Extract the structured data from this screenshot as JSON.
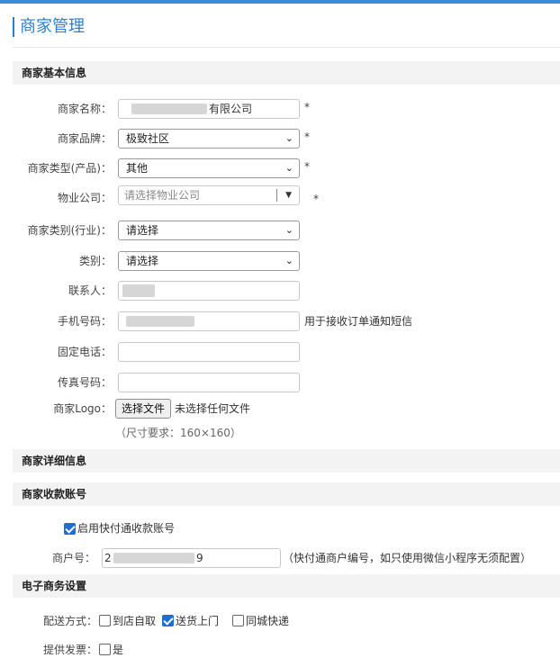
{
  "page": {
    "title": "商家管理"
  },
  "sections": {
    "basic": "商家基本信息",
    "detail": "商家详细信息",
    "account": "商家收款账号",
    "ecommerce": "电子商务设置"
  },
  "basic_form": {
    "name": {
      "label": "商家名称：",
      "value": "有限公司",
      "required_mark": "*"
    },
    "brand": {
      "label": "商家品牌：",
      "selected": "极致社区",
      "required_mark": "*"
    },
    "type": {
      "label": "商家类型(产品)：",
      "selected": "其他",
      "required_mark": "*"
    },
    "property": {
      "label": "物业公司：",
      "placeholder": "请选择物业公司",
      "required_mark": "*"
    },
    "industry": {
      "label": "商家类别(行业)：",
      "selected": "请选择"
    },
    "category": {
      "label": "类别：",
      "selected": "请选择"
    },
    "contact": {
      "label": "联系人：",
      "value": ""
    },
    "mobile": {
      "label": "手机号码：",
      "value": "",
      "hint": "用于接收订单通知短信"
    },
    "phone": {
      "label": "固定电话：",
      "value": ""
    },
    "fax": {
      "label": "传真号码：",
      "value": ""
    },
    "logo": {
      "label": "商家Logo：",
      "button": "选择文件",
      "status": "未选择任何文件",
      "size_note": "（尺寸要求：160×160）"
    }
  },
  "account_form": {
    "enable": {
      "label": "启用快付通收款账号",
      "checked": true
    },
    "merchant_no": {
      "label": "商户号：",
      "value_prefix": "2",
      "value_suffix": "9",
      "hint": "（快付通商户编号，如只使用微信小程序无须配置）"
    }
  },
  "ecommerce_form": {
    "delivery": {
      "label": "配送方式：",
      "options": [
        {
          "label": "到店自取",
          "checked": false
        },
        {
          "label": "送货上门",
          "checked": true
        },
        {
          "label": "同城快递",
          "checked": false
        }
      ]
    },
    "invoice": {
      "label": "提供发票：",
      "option": {
        "label": "是",
        "checked": false
      }
    }
  },
  "colors": {
    "accent": "#2a7fd4",
    "checkbox": "#1f6fd1",
    "section_bg": "#f3f3f3"
  },
  "icons": {
    "select_chevron": "chevron-down-icon",
    "combo_arrow": "triangle-down-icon"
  }
}
